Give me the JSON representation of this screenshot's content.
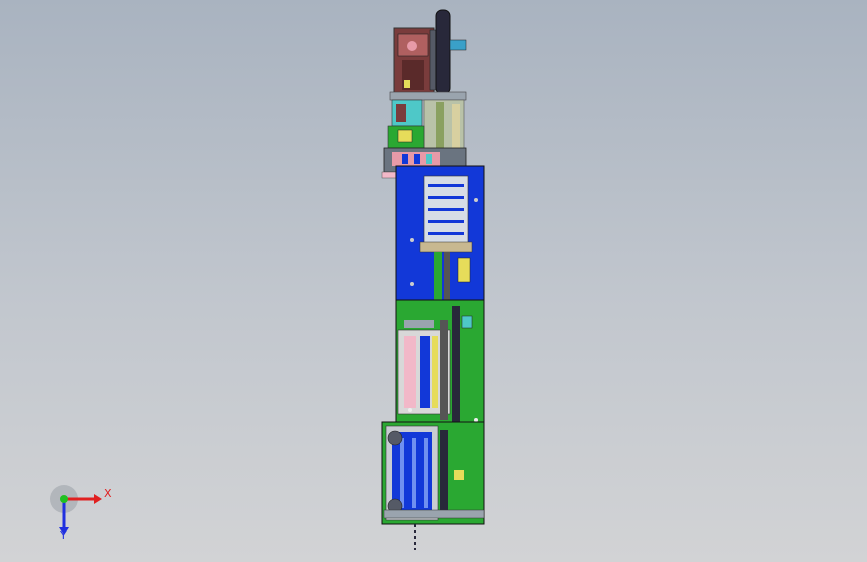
{
  "viewport": {
    "background_top": "#a9b3c0",
    "background_bottom": "#d2d3d5"
  },
  "model": {
    "colors": {
      "frame_blue": "#1238d8",
      "frame_green": "#2aa832",
      "motor_brown": "#7a3c3c",
      "wheel_dark": "#28283a",
      "rail_gray": "#9aa4ae",
      "accent_pink": "#e79aa8",
      "accent_yellow": "#e6dc5a",
      "accent_cyan": "#4ec8c8"
    }
  },
  "triad": {
    "x_label": "X",
    "y_label": "Y",
    "colors": {
      "x": "#e02020",
      "y": "#20c020",
      "z": "#2030e0"
    }
  }
}
